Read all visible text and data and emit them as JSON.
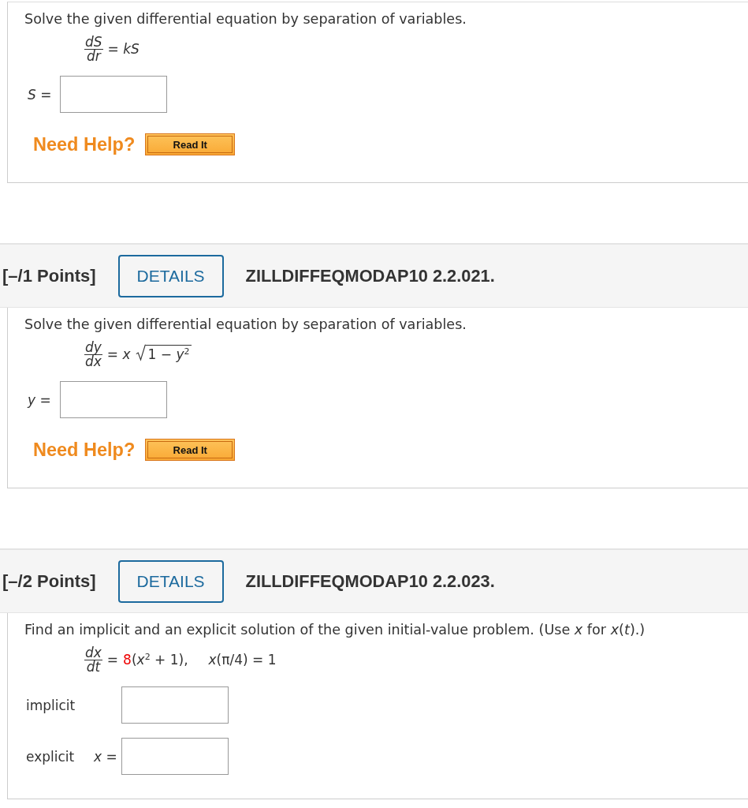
{
  "questions": [
    {
      "prompt": "Solve the given differential equation by separation of variables.",
      "equation": {
        "numerator": "dS",
        "denominator": "dr",
        "rhs": [
          {
            "kind": "text",
            "text": "= *kS*",
            "highlighted": false
          }
        ]
      },
      "answers": [
        {
          "label": "*S* =",
          "math": true
        }
      ],
      "help": {
        "label": "Need Help?",
        "button": "Read It"
      }
    },
    {
      "header": {
        "points": "[–/1 Points]",
        "details": "DETAILS",
        "code": "ZILLDIFFEQMODAP10 2.2.021."
      },
      "prompt": "Solve the given differential equation by separation of variables.",
      "equation": {
        "numerator": "dy",
        "denominator": "dx",
        "rhs": [
          {
            "kind": "text",
            "text": "= *x*",
            "highlighted": false
          },
          {
            "kind": "sqrt",
            "text": "1 − *y*$^{2}$",
            "highlighted": false
          }
        ]
      },
      "answers": [
        {
          "label": "*y* =",
          "math": true
        }
      ],
      "help": {
        "label": "Need Help?",
        "button": "Read It"
      }
    },
    {
      "header": {
        "points": "[–/2 Points]",
        "details": "DETAILS",
        "code": "ZILLDIFFEQMODAP10 2.2.023."
      },
      "prompt": "Find an implicit and an explicit solution of the given initial-value problem. (Use *x* for  *x*(*t*).)",
      "equation": {
        "numerator": "dx",
        "denominator": "dt",
        "rhs": [
          {
            "kind": "text",
            "text": "=",
            "highlighted": false
          },
          {
            "kind": "text",
            "text": "8",
            "highlighted": true
          },
          {
            "kind": "text",
            "text": "(*x*$^{2}$ + 1),",
            "highlighted": false
          },
          {
            "kind": "gap"
          },
          {
            "kind": "text",
            "text": "*x*(π/4) = 1",
            "highlighted": false
          }
        ]
      },
      "answers": [
        {
          "label": "implicit",
          "math": false
        },
        {
          "label": "explicit",
          "prefix": "*x* =",
          "math": false
        }
      ]
    }
  ]
}
